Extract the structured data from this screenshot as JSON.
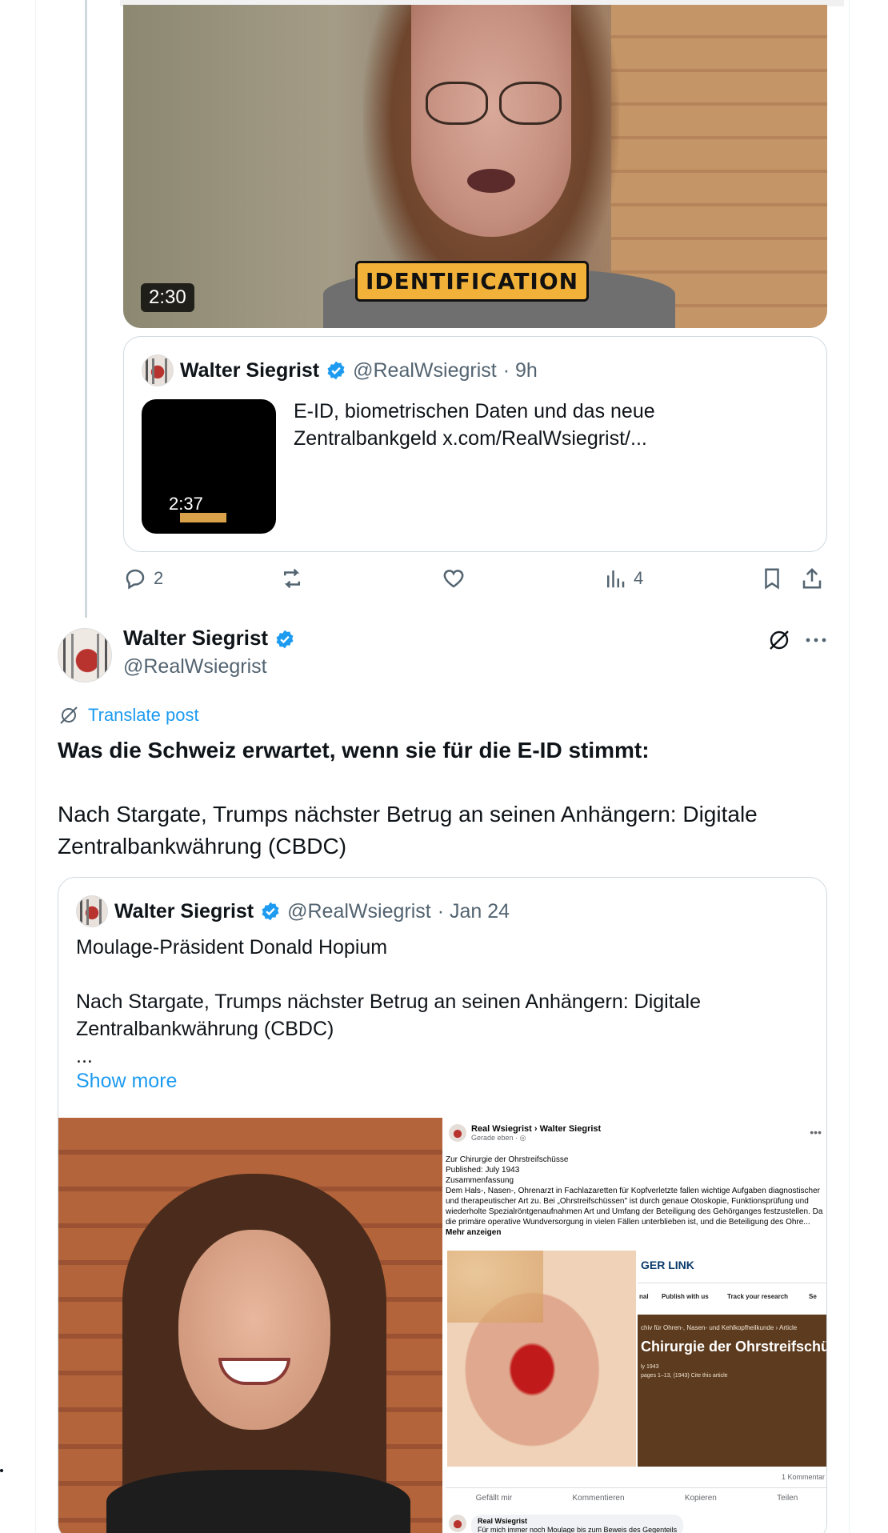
{
  "previous_post": {
    "video": {
      "caption": "IDENTIFICATION",
      "duration": "2:30"
    },
    "quoted": {
      "author_name": "Walter Siegrist",
      "author_handle": "@RealWsiegrist",
      "time": "· 9h",
      "thumb_duration": "2:37",
      "text": "E-ID, biometrischen Daten und das neue Zentralbankgeld  x.com/RealWsiegrist/..."
    },
    "actions": {
      "replies": "2",
      "reposts": "",
      "likes": "",
      "views": "4"
    }
  },
  "post": {
    "author_name": "Walter Siegrist",
    "author_handle": "@RealWsiegrist",
    "translate_label": "Translate post",
    "headline": "Was die Schweiz erwartet, wenn sie für die E-ID stimmt:",
    "body": "Nach Stargate, Trumps nächster Betrug an seinen Anhängern: Digitale Zentralbankwährung (CBDC)",
    "quoted": {
      "author_name": "Walter Siegrist",
      "author_handle": "@RealWsiegrist",
      "time": "· Jan 24",
      "line1": "Moulage-Präsident Donald Hopium",
      "line2": "Nach Stargate, Trumps nächster Betrug an seinen Anhängern: Digitale Zentralbankwährung (CBDC)",
      "ellipsis": "...",
      "show_more": "Show more",
      "fb_post": {
        "name": "Real Wsiegrist › Walter Siegrist",
        "time": "Gerade eben · ◎",
        "text_l1": "Zur Chirurgie der Ohrstreifschüsse",
        "text_l2": "Published: July 1943",
        "text_l3": "Zusammenfassung",
        "text_body": "Dem Hals-, Nasen-, Ohrenarzt in Fachlazaretten für Kopfverletzte fallen wichtige Aufgaben diagnostischer und therapeutischer Art zu. Bei „Ohrstreifschüssen\" ist durch genaue Otoskopie, Funktionsprüfung und wiederholte Spezialröntgenaufnahmen Art und Umfang der Beteiligung des Gehörganges festzustellen. Da die primäre operative Wundversorgung in vielen Fällen unterblieben ist, und die Beteiligung des Ohre...",
        "more": "Mehr anzeigen",
        "link_brand": "GER LINK",
        "nav1": "nal",
        "nav2": "Publish with us",
        "nav3": "Track your research",
        "nav4": "Se",
        "crumb": "chiv für Ohren-, Nasen- und Kehlkopfheilkunde › Article",
        "article_title": "Chirurgie der Ohrstreifschü",
        "meta1": "ly 1943",
        "meta2": "pages 1–13, (1943)   Cite this article",
        "comment_count": "1 Kommentar",
        "like": "Gefällt mir",
        "comment": "Kommentieren",
        "copy": "Kopieren",
        "share": "Teilen",
        "commenter": "Real Wsiegrist",
        "comment_text": "Für mich immer noch Moulage bis zum Beweis des Gegenteils"
      }
    }
  },
  "colors": {
    "accent": "#1d9bf0",
    "verified": "#1d9bf0",
    "muted": "#536471",
    "border": "#cfd9de"
  },
  "icons": [
    "reply-icon",
    "repost-icon",
    "like-icon",
    "views-icon",
    "bookmark-icon",
    "share-icon",
    "grok-icon",
    "more-icon",
    "translate-icon",
    "verified-icon"
  ]
}
